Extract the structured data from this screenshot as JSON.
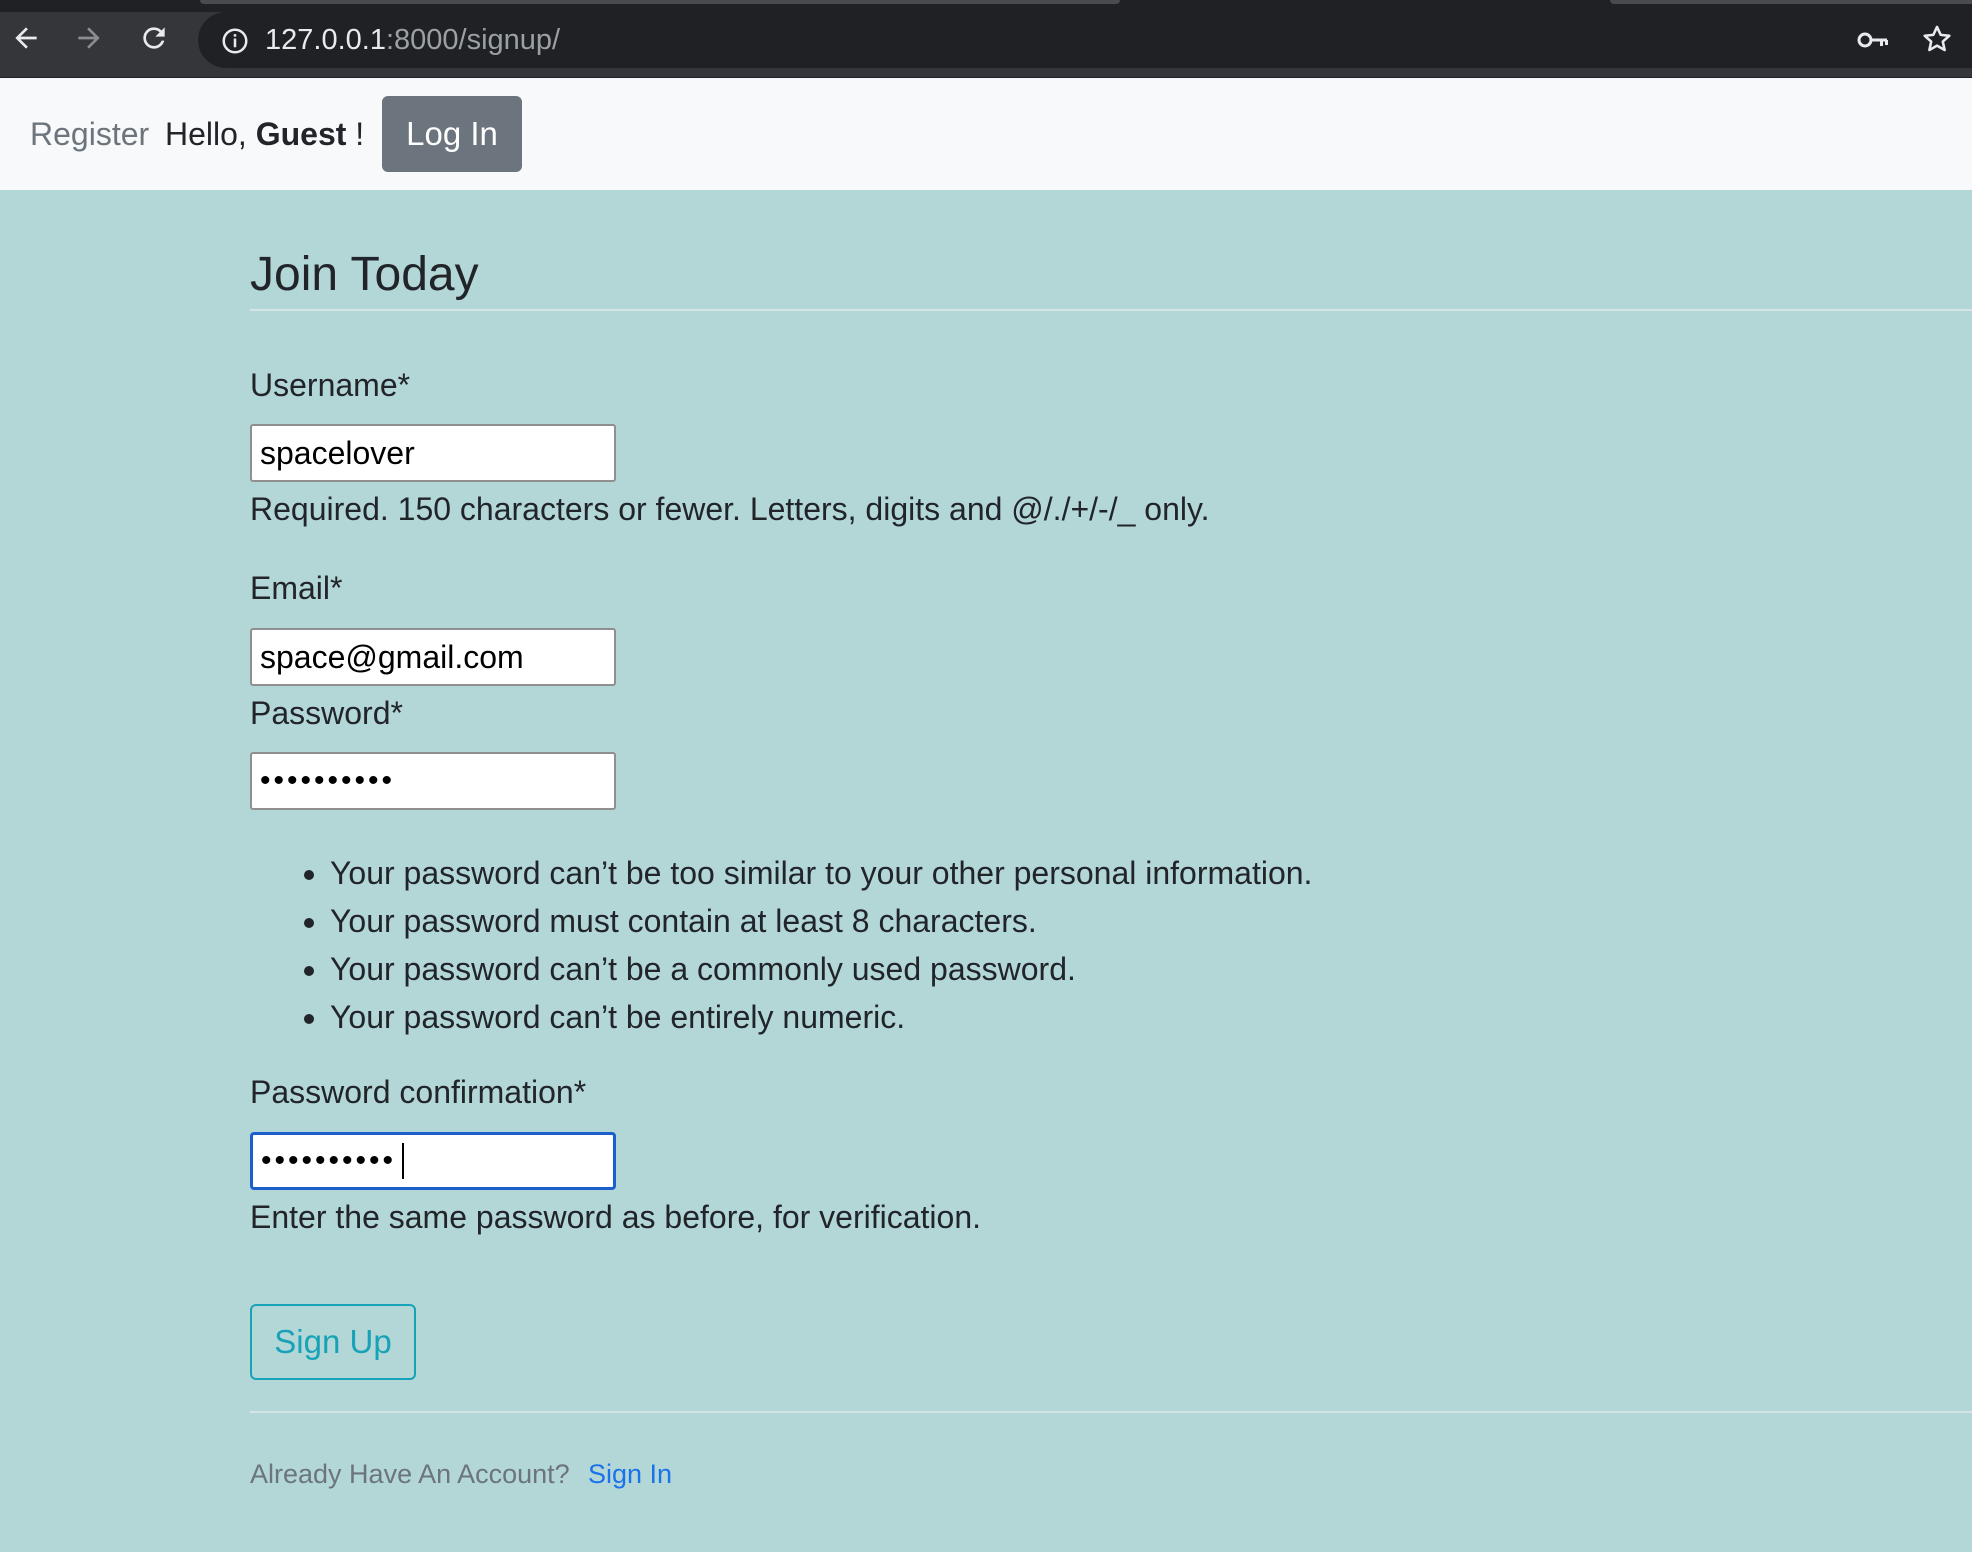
{
  "browser": {
    "url_host": "127.0.0.1",
    "url_path": ":8000/signup/"
  },
  "navbar": {
    "register_label": "Register",
    "greeting_prefix": "Hello, ",
    "greeting_user": "Guest",
    "greeting_suffix": " !",
    "login_label": "Log In"
  },
  "form": {
    "title": "Join Today",
    "username": {
      "label": "Username*",
      "value": "spacelover",
      "help": "Required. 150 characters or fewer. Letters, digits and @/./+/-/_ only."
    },
    "email": {
      "label": "Email*",
      "value": "space@gmail.com"
    },
    "password": {
      "label": "Password*",
      "value": "••••••••••",
      "rules": [
        "Your password can’t be too similar to your other personal information.",
        "Your password must contain at least 8 characters.",
        "Your password can’t be a commonly used password.",
        "Your password can’t be entirely numeric."
      ]
    },
    "password_confirmation": {
      "label": "Password confirmation*",
      "value": "••••••••••",
      "help": "Enter the same password as before, for verification."
    },
    "submit_label": "Sign Up"
  },
  "footer": {
    "text": "Already Have An Account?",
    "link_label": "Sign In"
  }
}
